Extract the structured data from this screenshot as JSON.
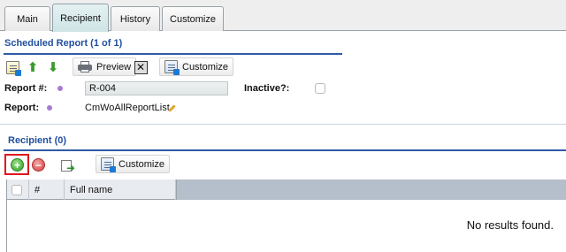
{
  "tabs": [
    {
      "label": "Main",
      "active": false
    },
    {
      "label": "Recipient",
      "active": true
    },
    {
      "label": "History",
      "active": false
    },
    {
      "label": "Customize",
      "active": false
    }
  ],
  "report_section": {
    "title": "Scheduled Report (1 of 1)",
    "toolbar": {
      "preview_label": "Preview",
      "customize_label": "Customize"
    },
    "fields": {
      "report_number_label": "Report #:",
      "report_number_value": "R-004",
      "inactive_label": "Inactive?:",
      "inactive_checked": false,
      "report_label": "Report:",
      "report_value": "CmWoAllReportList"
    }
  },
  "recipient_section": {
    "title": "Recipient (0)",
    "toolbar": {
      "customize_label": "Customize"
    },
    "grid": {
      "columns": [
        "#",
        "Full name"
      ],
      "empty_message": "No results found."
    }
  },
  "colors": {
    "accent": "#2f5aa6",
    "section_title": "#1f4f9e",
    "highlight": "#e0151e"
  }
}
